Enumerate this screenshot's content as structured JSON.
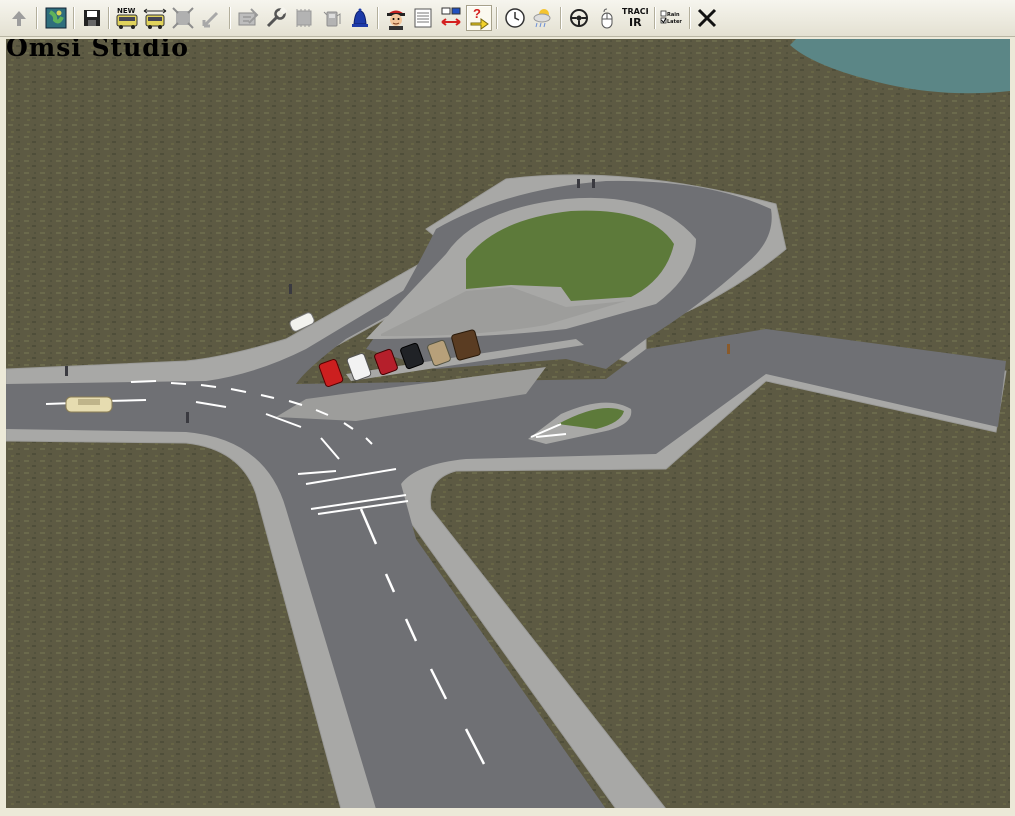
{
  "app": {
    "title": "Omsi Studio"
  },
  "toolbar": {
    "new_label": "NEW",
    "track_label_top": "TRACK",
    "track_label_bottom": "IR",
    "checkbox_top_label": "Rain",
    "checkbox_bottom_label": "Later"
  },
  "colors": {
    "grass": "#5d5a43",
    "asphalt": "#6f7074",
    "curb": "#a8a8a6",
    "lawn": "#5d7a3a",
    "water": "#5b8686"
  },
  "icons": [
    "up-arrow-icon",
    "map-icon",
    "save-icon",
    "new-bus-icon",
    "bus-resize-icon",
    "fit-view-icon",
    "pointer-icon",
    "bus-settings-icon",
    "wrench-icon",
    "chip-icon",
    "fuel-icon",
    "bell-icon",
    "driver-icon",
    "timetable-icon",
    "swap-icon",
    "help-icon",
    "clock-icon",
    "weather-icon",
    "steering-wheel-icon",
    "mouse-icon",
    "track-ir-icon",
    "checkbox-toggle-icon",
    "close-icon"
  ]
}
